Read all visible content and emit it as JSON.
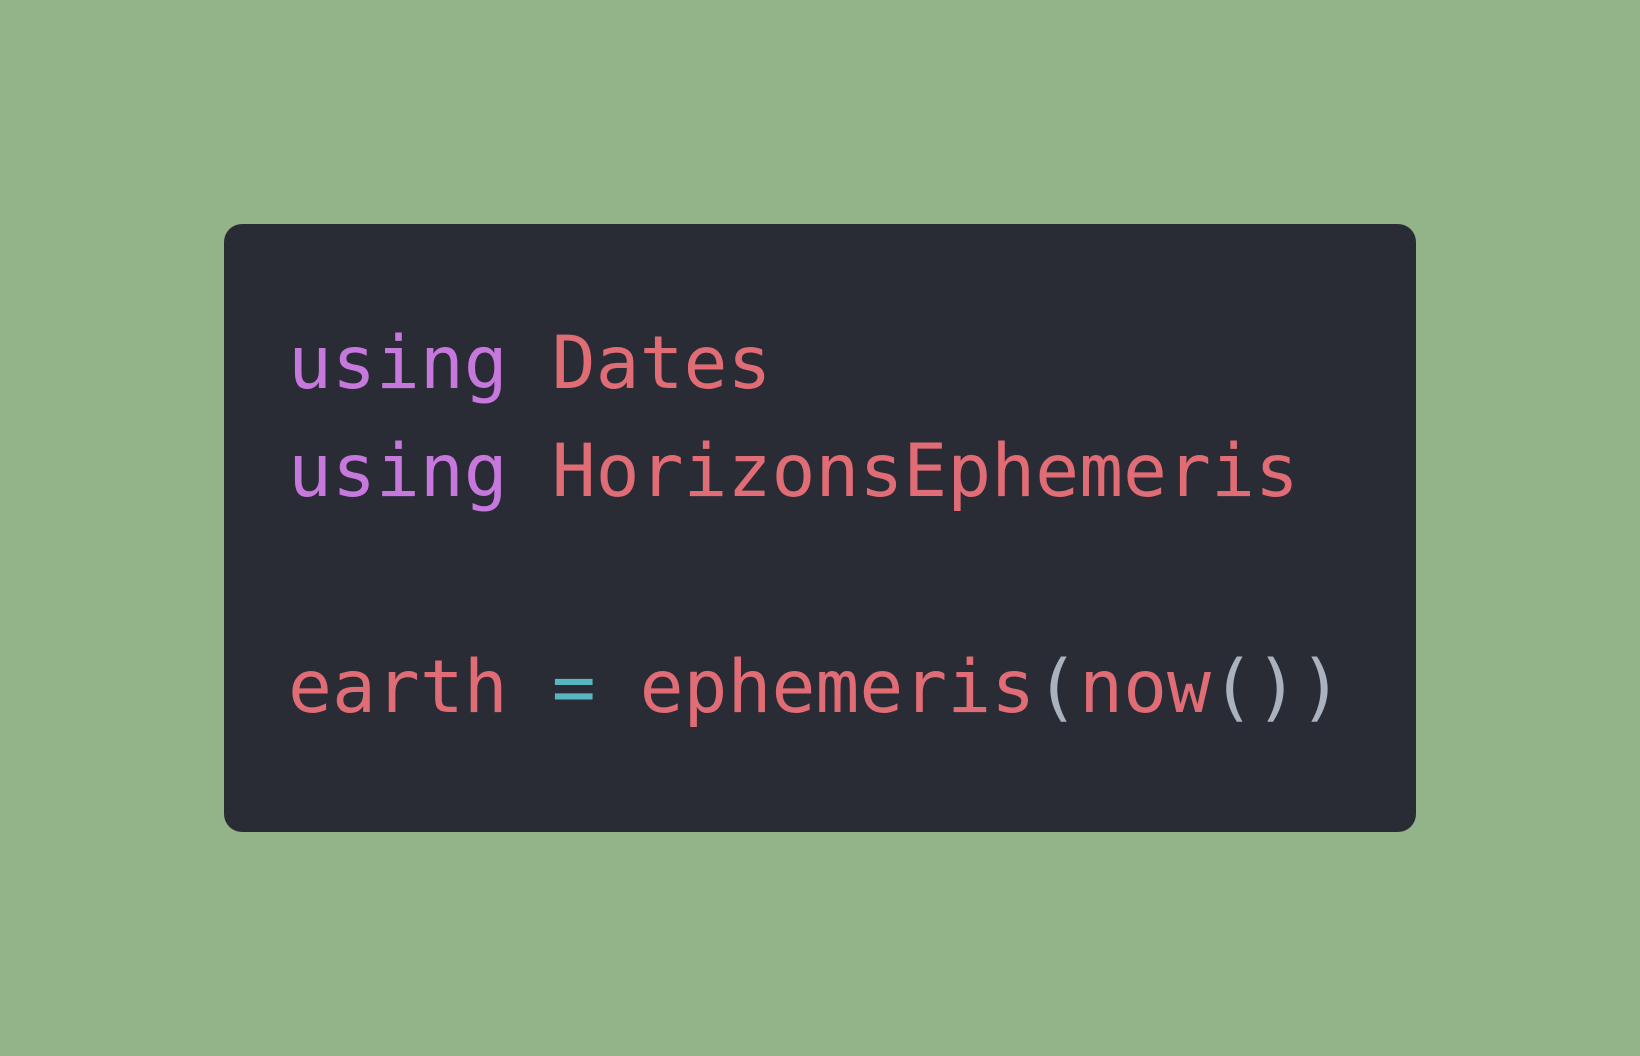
{
  "colors": {
    "background": "#93b388",
    "editor_background": "#292c35",
    "keyword": "#c678dd",
    "identifier": "#e06c75",
    "operator": "#56b6c2",
    "punctuation": "#abb2bf"
  },
  "code": {
    "lines": [
      {
        "tokens": [
          {
            "type": "keyword",
            "text": "using"
          },
          {
            "type": "space",
            "text": " "
          },
          {
            "type": "identifier",
            "text": "Dates"
          }
        ]
      },
      {
        "tokens": [
          {
            "type": "keyword",
            "text": "using"
          },
          {
            "type": "space",
            "text": " "
          },
          {
            "type": "identifier",
            "text": "HorizonsEphemeris"
          }
        ]
      },
      {
        "tokens": []
      },
      {
        "tokens": [
          {
            "type": "identifier",
            "text": "earth"
          },
          {
            "type": "space",
            "text": " "
          },
          {
            "type": "operator",
            "text": "="
          },
          {
            "type": "space",
            "text": " "
          },
          {
            "type": "identifier",
            "text": "ephemeris"
          },
          {
            "type": "punctuation",
            "text": "("
          },
          {
            "type": "identifier",
            "text": "now"
          },
          {
            "type": "punctuation",
            "text": "()"
          },
          {
            "type": "punctuation",
            "text": ")"
          }
        ]
      }
    ]
  }
}
